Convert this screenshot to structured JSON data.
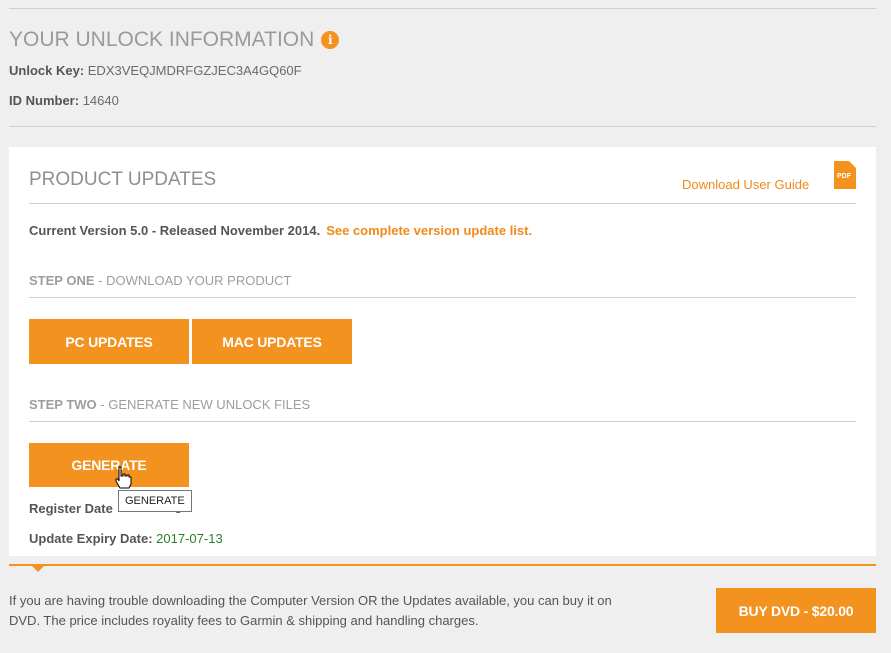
{
  "unlock": {
    "title": "YOUR UNLOCK INFORMATION",
    "info_icon": "i",
    "key_label": "Unlock Key:",
    "key_value": "EDX3VEQJMDRFGZJEC3A4GQ60F",
    "id_label": "ID Number:",
    "id_value": "14640"
  },
  "updates": {
    "title": "PRODUCT UPDATES",
    "guide_link": "Download User Guide",
    "pdf_label": "PDF",
    "version_text": "Current Version 5.0 - Released November 2014.",
    "version_link": "See complete version update list.",
    "step_one_label": "STEP ONE",
    "step_one_text": " - DOWNLOAD YOUR PRODUCT",
    "pc_button": "PC UPDATES",
    "mac_button": "MAC UPDATES",
    "step_two_label": "STEP TWO",
    "step_two_text": " - GENERATE NEW UNLOCK FILES",
    "generate_button": "GENERATE",
    "tooltip": "GENERATE",
    "register_label": "Register Date",
    "register_value": "3",
    "expiry_label": "Update Expiry Date:",
    "expiry_value": "2017-07-13"
  },
  "dvd": {
    "text": "If you are having trouble downloading the Computer Version OR the Updates available, you can buy it on DVD. The price includes royality fees to Garmin & shipping and handling charges.",
    "button": "BUY DVD - $20.00"
  },
  "colors": {
    "accent": "#f3921f",
    "link": "#f08a1a",
    "expiry": "#2e7d2e"
  }
}
